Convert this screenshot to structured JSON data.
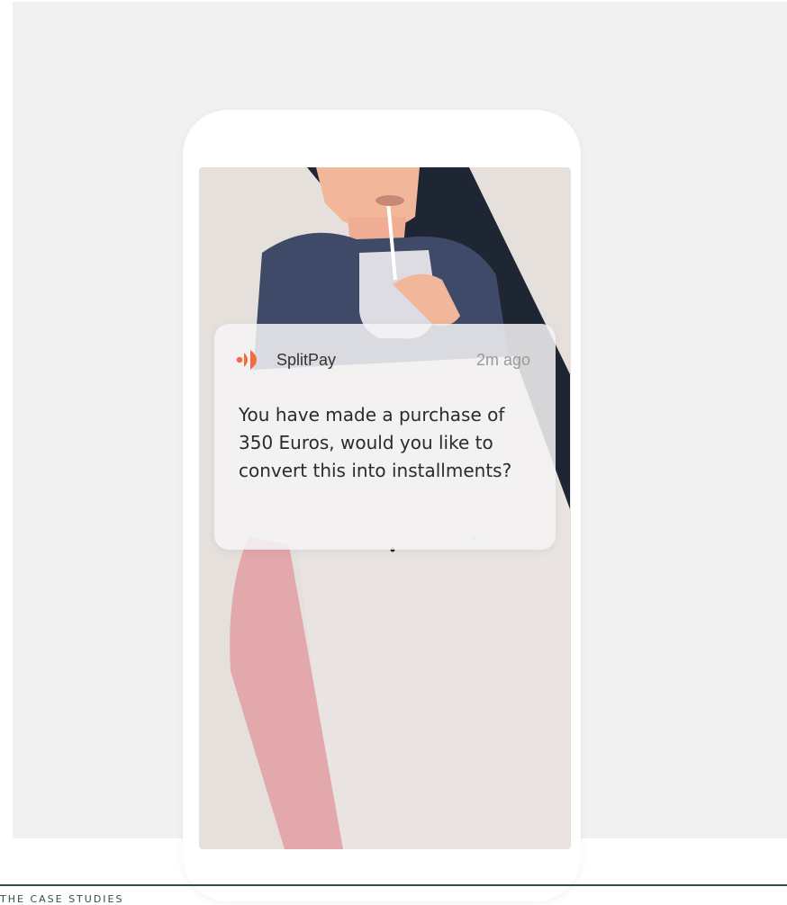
{
  "notification": {
    "app_name": "SplitPay",
    "logo_icon": "splitpay-logo-icon",
    "time": "2m ago",
    "message": "You have made a purchase of 350 Euros, would you like to convert this into installments?"
  },
  "footer": {
    "label": "THE CASE STUDIES"
  },
  "colors": {
    "accent": "#f26a3d",
    "page_background": "#f1f1f1",
    "screen_background": "#e6e0dd",
    "footer_rule": "#2f4f4f"
  }
}
